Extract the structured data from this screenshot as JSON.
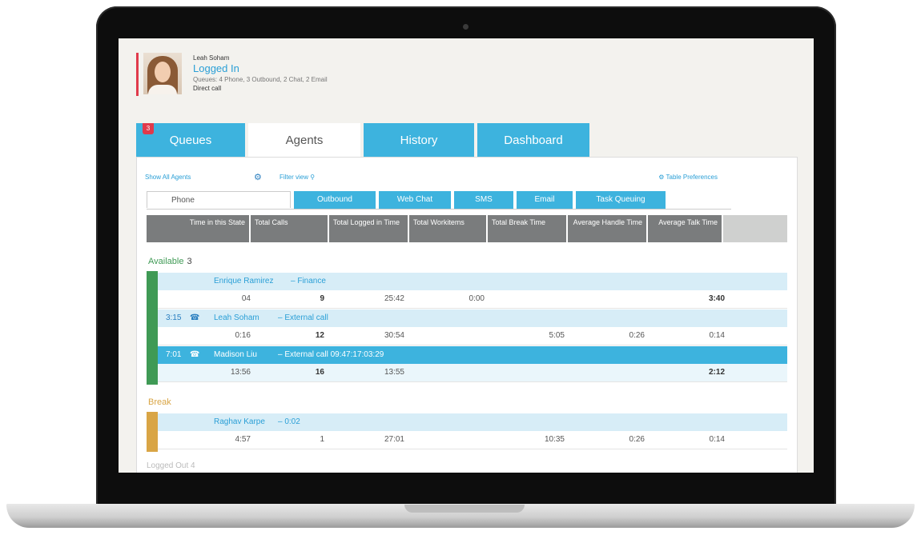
{
  "agent": {
    "name": "Leah Soham",
    "status": "Logged In",
    "queues": "Queues: 4 Phone, 3 Outbound, 2 Chat, 2 Email",
    "mode": "Direct call"
  },
  "tabs": [
    {
      "label": "Queues",
      "badge": "3"
    },
    {
      "label": "Agents"
    },
    {
      "label": "History"
    },
    {
      "label": "Dashboard"
    }
  ],
  "toolbar": {
    "show_all": "Show All Agents",
    "filter": "Filter view",
    "table_pref": "Table Preferences"
  },
  "subtabs": [
    "Phone",
    "Outbound",
    "Web Chat",
    "SMS",
    "Email",
    "Task Queuing"
  ],
  "columns": [
    "Time in this State",
    "Total Calls",
    "Total Logged in Time",
    "Total Workitems",
    "Total Break Time",
    "Average Handle Time",
    "Average Talk Time"
  ],
  "groups": {
    "available": {
      "label": "Available",
      "count": "3",
      "color": "#3f9a55",
      "agents": [
        {
          "time": "",
          "name": "Enrique Ramirez",
          "meta": "– Finance",
          "cells": [
            "04",
            "9",
            "25:42",
            "0:00",
            "",
            "",
            "3:40"
          ]
        },
        {
          "time": "3:15",
          "name": "Leah Soham",
          "meta": "– External call",
          "cells": [
            "0:16",
            "12",
            "30:54",
            "",
            "5:05",
            "0:26",
            "0:14"
          ]
        },
        {
          "time": "7:01",
          "name": "Madison Liu",
          "meta": "– External call 09:47:17:03:29",
          "cells": [
            "13:56",
            "16",
            "13:55",
            "",
            "",
            "",
            "2:12"
          ]
        }
      ]
    },
    "break": {
      "label": "Break",
      "count": "",
      "color": "#d9a545",
      "agents": [
        {
          "time": "",
          "name": "Raghav Karpe",
          "meta": "– 0:02",
          "cells": [
            "4:57",
            "1",
            "27:01",
            "",
            "10:35",
            "0:26",
            "0:14"
          ]
        }
      ]
    },
    "logged_out": {
      "label": "Logged Out",
      "count": "4"
    }
  },
  "colors": {
    "accent": "#3db3de",
    "header_gray": "#7a7c7d",
    "alert": "#e03a4b"
  }
}
